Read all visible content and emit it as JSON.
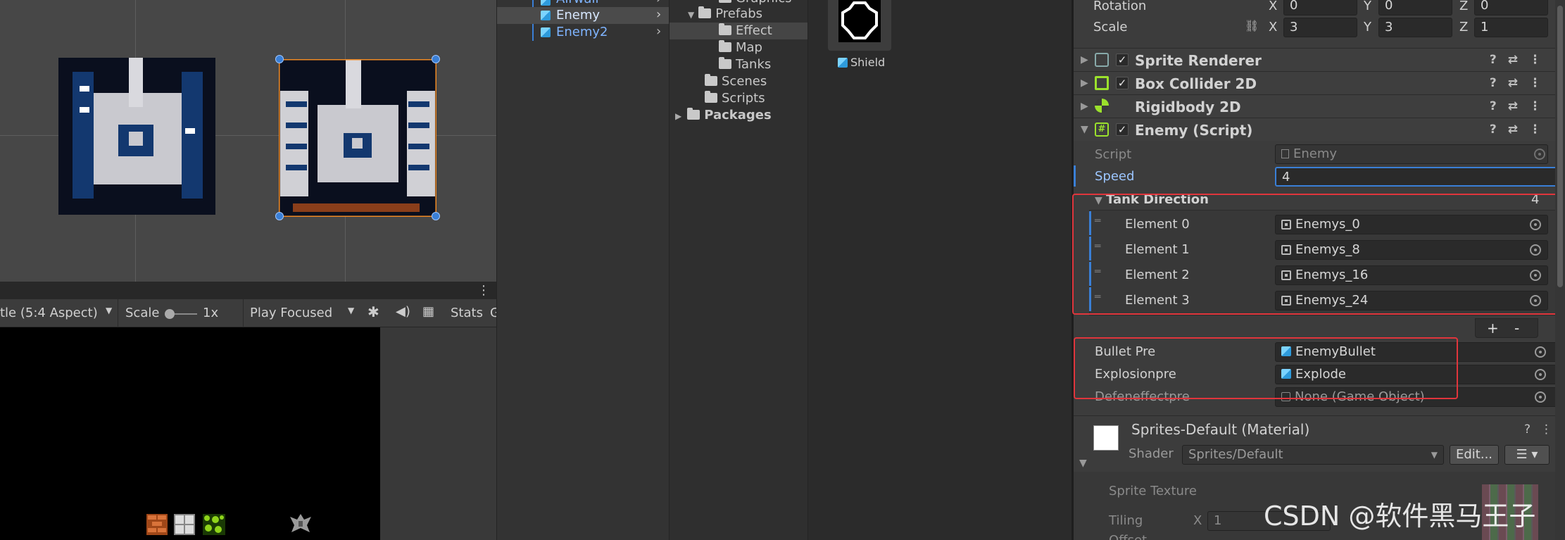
{
  "scene": {},
  "game_toolbar": {
    "aspect": "tle (5:4 Aspect)",
    "scale_label": "Scale",
    "scale_value": "1x",
    "play_mode": "Play Focused",
    "stats": "Stats",
    "cut": "G"
  },
  "hierarchy": {
    "items": [
      {
        "label": "Airwall"
      },
      {
        "label": "Enemy"
      },
      {
        "label": "Enemy2"
      }
    ]
  },
  "project_folders": {
    "items": [
      {
        "label": "Graphics"
      },
      {
        "label": "Prefabs"
      },
      {
        "label": "Effect"
      },
      {
        "label": "Map"
      },
      {
        "label": "Tanks"
      },
      {
        "label": "Scenes"
      },
      {
        "label": "Scripts"
      },
      {
        "label": "Packages"
      }
    ]
  },
  "assets": {
    "shield_label": "Shield"
  },
  "inspector": {
    "transform": {
      "rotation_label": "Rotation",
      "scale_label": "Scale",
      "rot_x": "0",
      "rot_y": "0",
      "rot_z": "0",
      "scale_x": "3",
      "scale_y": "3",
      "scale_z": "1",
      "x": "X",
      "y": "Y",
      "z": "Z"
    },
    "components": [
      {
        "label": "Sprite Renderer"
      },
      {
        "label": "Box Collider 2D"
      },
      {
        "label": "Rigidbody 2D"
      },
      {
        "label": "Enemy (Script)"
      }
    ],
    "script": {
      "script_label": "Script",
      "script_value": "Enemy",
      "speed_label": "Speed",
      "speed_value": "4",
      "tank_direction_label": "Tank Direction",
      "tank_direction_size": "4",
      "elements": [
        {
          "label": "Element 0",
          "value": "Enemys_0"
        },
        {
          "label": "Element 1",
          "value": "Enemys_8"
        },
        {
          "label": "Element 2",
          "value": "Enemys_16"
        },
        {
          "label": "Element 3",
          "value": "Enemys_24"
        }
      ],
      "add": "+",
      "remove": "-",
      "bullet_label": "Bullet Pre",
      "bullet_value": "EnemyBullet",
      "explosion_label": "Explosionpre",
      "explosion_value": "Explode",
      "defend_label": "Defeneffectpre",
      "defend_value": "None (Game Object)"
    },
    "material": {
      "name": "Sprites-Default (Material)",
      "shader_label": "Shader",
      "shader_value": "Sprites/Default",
      "edit": "Edit...",
      "sprite_texture": "Sprite Texture",
      "tiling": "Tiling",
      "tiling_x": "1",
      "offset": "Offset"
    }
  },
  "watermark": "CSDN @软件黑马王子",
  "colors": {
    "selection_box": "#e0353c",
    "accent_blue": "#3a7fd6",
    "orange_select": "#f08a24"
  }
}
